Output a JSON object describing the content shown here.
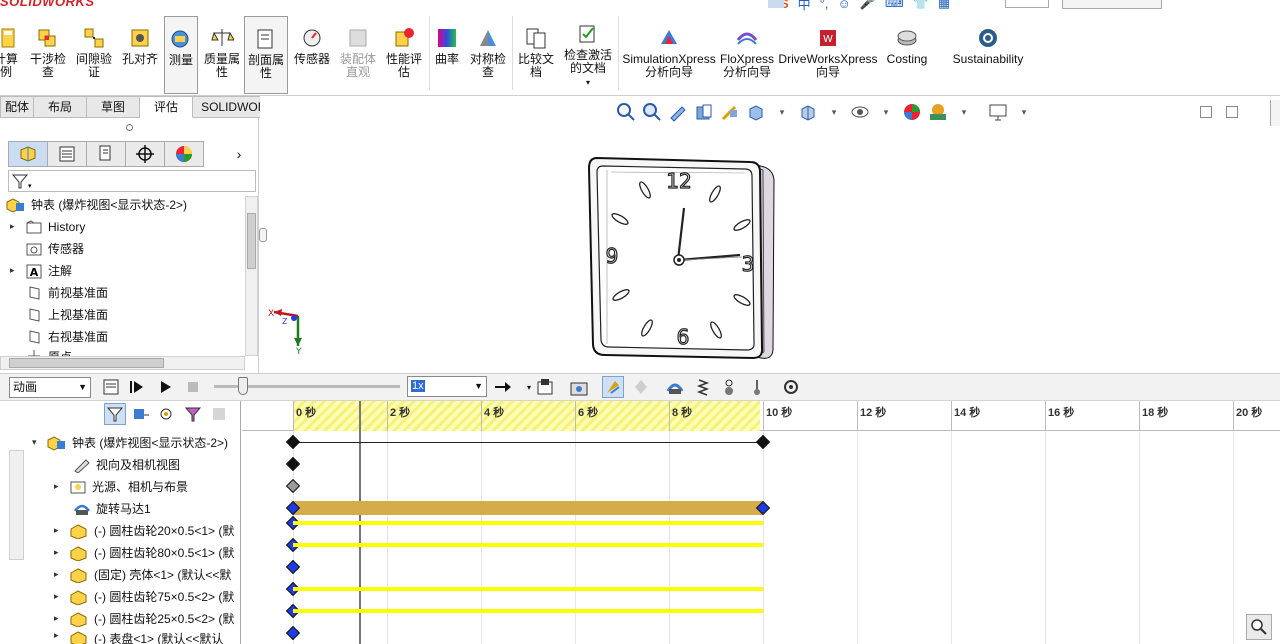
{
  "app": {
    "logo": "SOLIDWORKS"
  },
  "ime": [
    "S",
    "中",
    "°,",
    "☺",
    "🎤",
    "⌨",
    "👕",
    "▦"
  ],
  "commands": [
    {
      "label": "计算\n例",
      "icon": "calculate-icon"
    },
    {
      "label": "干涉检\n查",
      "icon": "interference-icon"
    },
    {
      "label": "间隙验\n证",
      "icon": "clearance-icon"
    },
    {
      "label": "孔对齐",
      "icon": "hole-align-icon"
    },
    {
      "label": "测量",
      "icon": "measure-icon"
    },
    {
      "label": "质量属\n性",
      "icon": "mass-properties-icon"
    },
    {
      "label": "剖面属\n性",
      "icon": "section-properties-icon"
    },
    {
      "label": "传感器",
      "icon": "sensor-icon"
    },
    {
      "label": "装配体\n直观",
      "icon": "assembly-visual-icon"
    },
    {
      "label": "性能评\n估",
      "icon": "performance-icon"
    },
    {
      "label": "曲率",
      "icon": "curvature-icon"
    },
    {
      "label": "对称检\n查",
      "icon": "symmetry-icon"
    },
    {
      "label": "比较文\n档",
      "icon": "compare-icon"
    },
    {
      "label": "检查激活\n的文档",
      "icon": "check-active-icon"
    },
    {
      "label": "SimulationXpress\n分析向导",
      "icon": "simulationxpress-icon"
    },
    {
      "label": "FloXpress\n分析向导",
      "icon": "floxpress-icon"
    },
    {
      "label": "DriveWorksXpress\n向导",
      "icon": "driveworksxpress-icon"
    },
    {
      "label": "Costing",
      "icon": "costing-icon"
    },
    {
      "label": "Sustainability",
      "icon": "sustainability-icon"
    }
  ],
  "tabs": [
    "配体",
    "布局",
    "草图",
    "评估",
    "SOLIDWORKS MBD"
  ],
  "feature_tree": {
    "root": "钟表  (爆炸视图<显示状态-2>)",
    "items": [
      "History",
      "传感器",
      "注解",
      "前视基准面",
      "上视基准面",
      "右视基准面",
      "原点"
    ]
  },
  "motion": {
    "study_type": "动画",
    "speed": "1x",
    "tree": [
      "钟表  (爆炸视图<显示状态-2>)",
      "视向及相机视图",
      "光源、相机与布景",
      "旋转马达1",
      "(-) 圆柱齿轮20×0.5<1>  (默",
      "(-) 圆柱齿轮80×0.5<1>  (默",
      "(固定) 壳体<1>  (默认<<默",
      "(-) 圆柱齿轮75×0.5<2>  (默",
      "(-) 圆柱齿轮25×0.5<2>  (默",
      "(-) 表盘<1>  (默认<<默认"
    ],
    "ticks": [
      "0 秒",
      "2 秒",
      "4 秒",
      "6 秒",
      "8 秒",
      "10 秒",
      "12 秒",
      "14 秒",
      "16 秒",
      "18 秒",
      "20 秒"
    ],
    "time_range": [
      0,
      20
    ],
    "duration": 10,
    "current_time": 1.4
  },
  "clock": {
    "numerals": [
      "12",
      "3",
      "6",
      "9"
    ]
  },
  "triad": {
    "x": "X",
    "y": "Y",
    "z": "Z"
  },
  "colors": {
    "accent": "#1f5fbf",
    "track_bar": "#d4ac48",
    "track_line": "#ffff00",
    "key_blue": "#1f3ce0",
    "logo_red": "#d4242b"
  }
}
